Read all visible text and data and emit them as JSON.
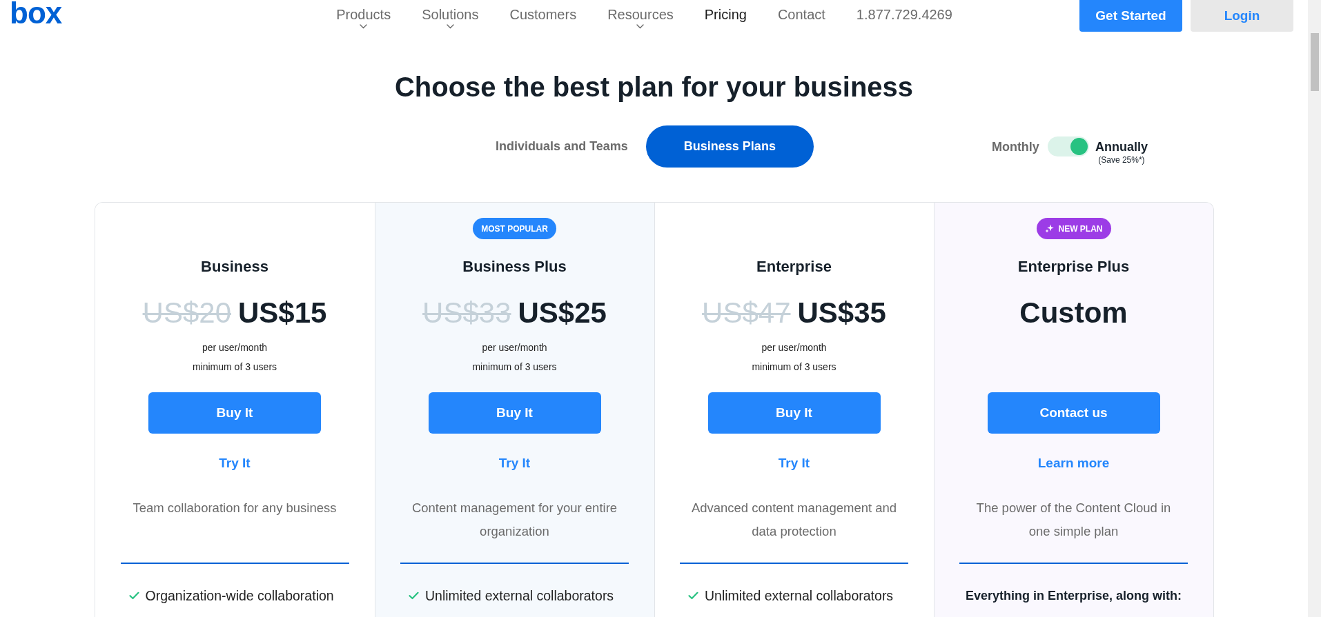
{
  "header": {
    "logo": "box",
    "nav": [
      {
        "label": "Products",
        "kind": "dropdown",
        "selected": false
      },
      {
        "label": "Solutions",
        "kind": "dropdown",
        "selected": false
      },
      {
        "label": "Customers",
        "kind": "link",
        "selected": false
      },
      {
        "label": "Resources",
        "kind": "dropdown",
        "selected": false
      },
      {
        "label": "Pricing",
        "kind": "link",
        "selected": true
      },
      {
        "label": "Contact",
        "kind": "link",
        "selected": false
      },
      {
        "label": "1.877.729.4269",
        "kind": "link",
        "selected": false
      }
    ],
    "buttons": [
      {
        "label": "Get Started",
        "kind": "primary"
      },
      {
        "label": "Login",
        "kind": "secondary"
      }
    ]
  },
  "title": "Choose the best plan for your business",
  "plan_tabs": [
    {
      "label": "Individuals and Teams",
      "selected": false
    },
    {
      "label": "Business Plans",
      "selected": true
    }
  ],
  "billing_toggle": {
    "left_label": "Monthly",
    "right_label": "Annually",
    "note": "(Save 25%*)",
    "on": true
  },
  "plans": [
    {
      "name": "Business",
      "price": {
        "kind": "discounted",
        "old": "US$20",
        "current": "US$15"
      },
      "price_notes": [
        "per user/month",
        "minimum of 3 users"
      ],
      "primary_button": "Buy It",
      "secondary_link": "Try It",
      "description": "Team collaboration for any business",
      "features": [
        {
          "kind": "check",
          "text": "Organization-wide collaboration"
        }
      ]
    },
    {
      "name": "Business Plus",
      "badge": {
        "kind": "popular",
        "label": "MOST POPULAR",
        "color": "#2486fc"
      },
      "price": {
        "kind": "discounted",
        "old": "US$33",
        "current": "US$25"
      },
      "price_notes": [
        "per user/month",
        "minimum of 3 users"
      ],
      "primary_button": "Buy It",
      "secondary_link": "Try It",
      "description": "Content management for your entire organization",
      "features": [
        {
          "kind": "check",
          "text": "Unlimited external collaborators"
        }
      ]
    },
    {
      "name": "Enterprise",
      "price": {
        "kind": "discounted",
        "old": "US$47",
        "current": "US$35"
      },
      "price_notes": [
        "per user/month",
        "minimum of 3 users"
      ],
      "primary_button": "Buy It",
      "secondary_link": "Try It",
      "description": "Advanced content management and data protection",
      "features": [
        {
          "kind": "check",
          "text": "Unlimited external collaborators"
        }
      ]
    },
    {
      "name": "Enterprise Plus",
      "badge": {
        "kind": "new",
        "label": "NEW PLAN",
        "color": "#9c3ce6"
      },
      "price": {
        "kind": "custom",
        "current": "Custom"
      },
      "primary_button": "Contact us",
      "secondary_link": "Learn more",
      "description": "The power of the Content Cloud in one simple plan",
      "features": [
        {
          "kind": "heading",
          "text": "Everything in Enterprise, along with:"
        }
      ]
    }
  ]
}
